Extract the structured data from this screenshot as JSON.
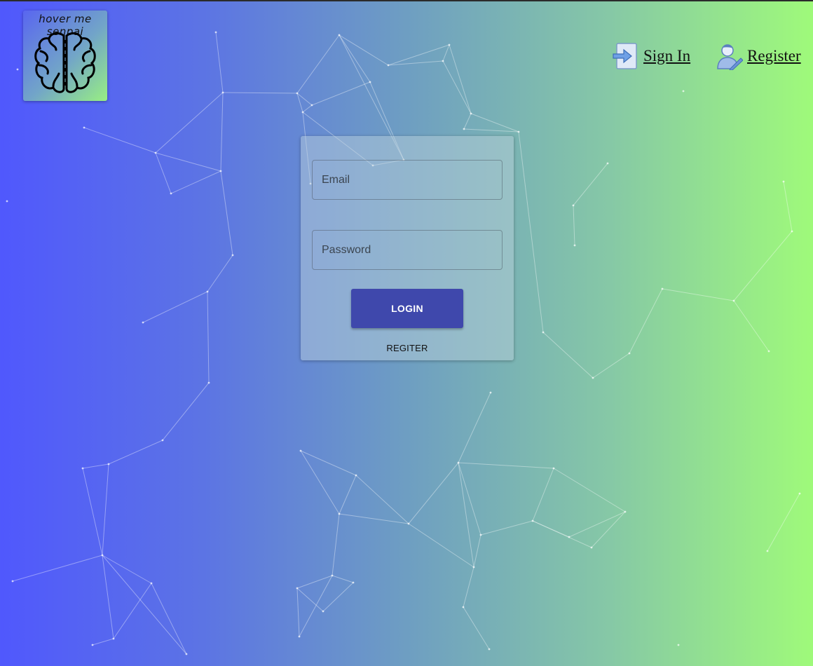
{
  "logo": {
    "caption": "hover me senpai",
    "icon": "brain-icon"
  },
  "nav": {
    "sign_in": {
      "label": "Sign In",
      "icon": "sign-in-icon"
    },
    "register": {
      "label": "Register",
      "icon": "user-register-icon"
    }
  },
  "login_form": {
    "email_placeholder": "Email",
    "password_placeholder": "Password",
    "login_label": "LOGIN",
    "register_label": "REGITER"
  },
  "colors": {
    "gradient_start": "#5058fd",
    "gradient_end": "#9ffa7a",
    "button_primary": "#3f48ac",
    "network_lines": "#ffffff"
  }
}
